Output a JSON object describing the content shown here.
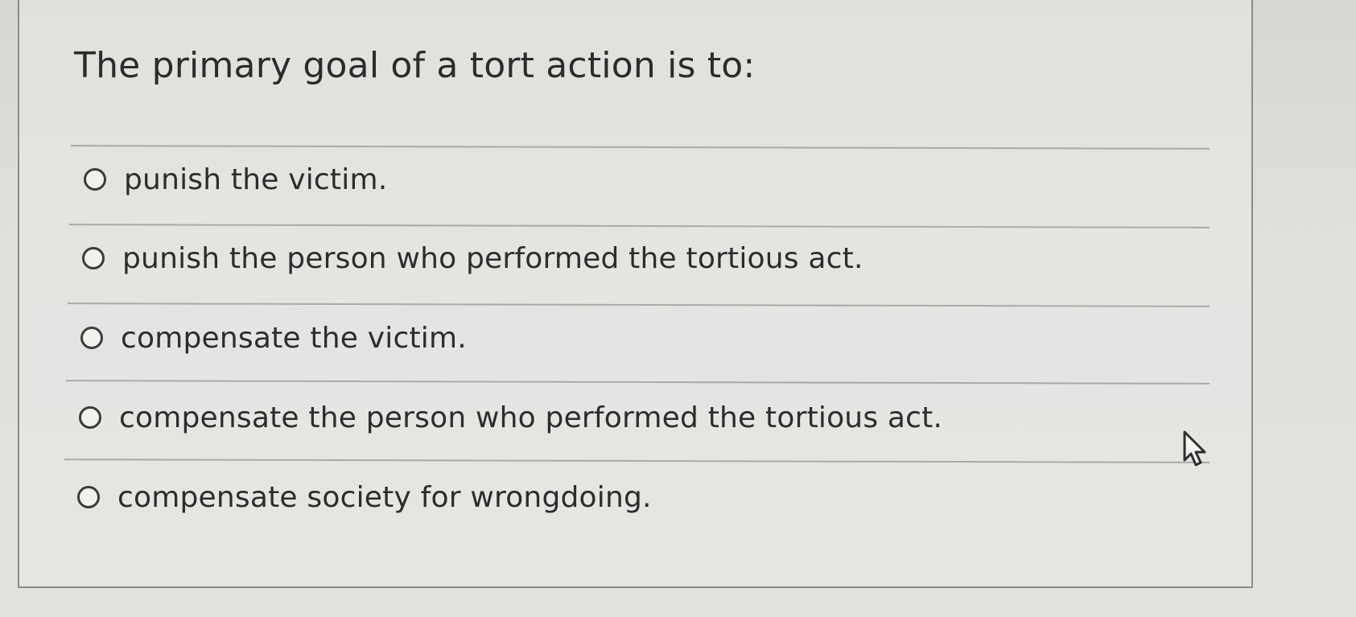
{
  "question": {
    "text": "The primary goal of a tort action is to:"
  },
  "options": [
    {
      "label": "punish the victim.",
      "selected": false
    },
    {
      "label": "punish the person who performed the tortious act.",
      "selected": false
    },
    {
      "label": "compensate the victim.",
      "selected": false
    },
    {
      "label": "compensate the person who performed the tortious act.",
      "selected": false
    },
    {
      "label": "compensate society for wrongdoing.",
      "selected": false
    }
  ],
  "cursor": {
    "icon": "arrow-pointer-icon"
  }
}
